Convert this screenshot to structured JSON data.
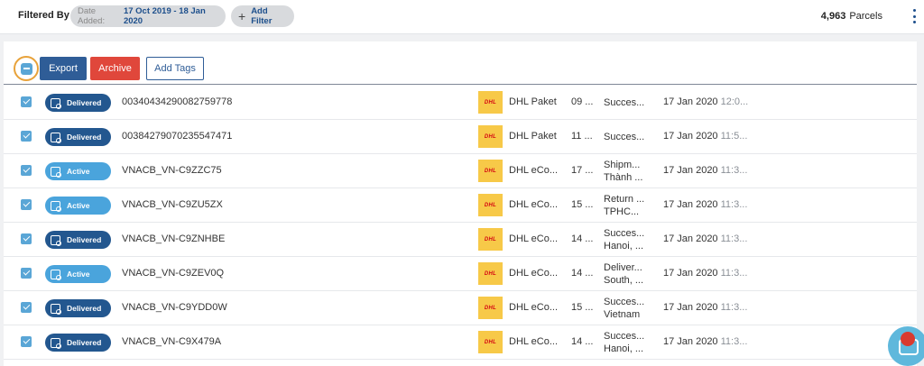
{
  "filter_bar": {
    "label": "Filtered By",
    "date_chip_key": "Date Added:",
    "date_chip_value": "17 Oct 2019 - 18 Jan 2020",
    "add_filter_label": "Add Filter",
    "count_value": "4,963",
    "count_unit": "Parcels"
  },
  "toolbar": {
    "export_label": "Export",
    "archive_label": "Archive",
    "add_tags_label": "Add Tags"
  },
  "colors": {
    "delivered": "#23578f",
    "active": "#4aa4dc",
    "archive": "#e0473b",
    "accent": "#2f5d97"
  },
  "rows": [
    {
      "status_badge": "Delivered",
      "tracking": "00340434290082759778",
      "courier": "DHL Paket",
      "num": "09 ...",
      "status_line1": "Succes...",
      "status_line2": "",
      "date": "17 Jan 2020",
      "time": "12:0..."
    },
    {
      "status_badge": "Delivered",
      "tracking": "00384279070235547471",
      "courier": "DHL Paket",
      "num": "11 ...",
      "status_line1": "Succes...",
      "status_line2": "",
      "date": "17 Jan 2020",
      "time": "11:5..."
    },
    {
      "status_badge": "Active",
      "tracking": "VNACB_VN-C9ZZC75",
      "courier": "DHL eCo...",
      "num": "17 ...",
      "status_line1": "Shipm...",
      "status_line2": "Thành ...",
      "date": "17 Jan 2020",
      "time": "11:3..."
    },
    {
      "status_badge": "Active",
      "tracking": "VNACB_VN-C9ZU5ZX",
      "courier": "DHL eCo...",
      "num": "15 ...",
      "status_line1": "Return ...",
      "status_line2": "TPHC...",
      "date": "17 Jan 2020",
      "time": "11:3..."
    },
    {
      "status_badge": "Delivered",
      "tracking": "VNACB_VN-C9ZNHBE",
      "courier": "DHL eCo...",
      "num": "14 ...",
      "status_line1": "Succes...",
      "status_line2": "Hanoi, ...",
      "date": "17 Jan 2020",
      "time": "11:3..."
    },
    {
      "status_badge": "Active",
      "tracking": "VNACB_VN-C9ZEV0Q",
      "courier": "DHL eCo...",
      "num": "14 ...",
      "status_line1": "Deliver...",
      "status_line2": "South, ...",
      "date": "17 Jan 2020",
      "time": "11:3..."
    },
    {
      "status_badge": "Delivered",
      "tracking": "VNACB_VN-C9YDD0W",
      "courier": "DHL eCo...",
      "num": "15 ...",
      "status_line1": "Succes...",
      "status_line2": "Vietnam",
      "date": "17 Jan 2020",
      "time": "11:3..."
    },
    {
      "status_badge": "Delivered",
      "tracking": "VNACB_VN-C9X479A",
      "courier": "DHL eCo...",
      "num": "14 ...",
      "status_line1": "Succes...",
      "status_line2": "Hanoi, ...",
      "date": "17 Jan 2020",
      "time": "11:3..."
    }
  ],
  "courier_logo_text": "DHL"
}
